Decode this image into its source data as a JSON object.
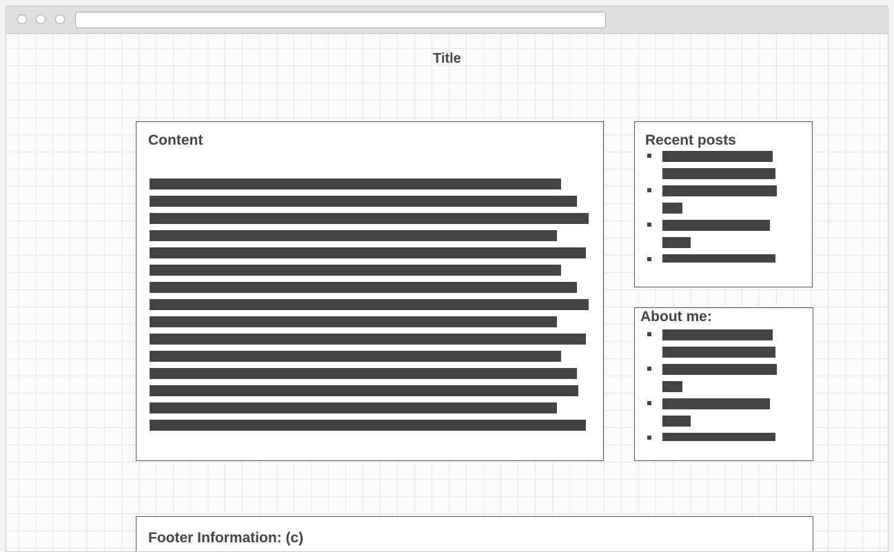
{
  "page": {
    "title": "Title"
  },
  "main": {
    "heading": "Content",
    "line_count": 15
  },
  "sidebar": {
    "recent_posts": {
      "heading": "Recent posts",
      "items_count": 4
    },
    "about": {
      "heading": "About me:",
      "items_count": 4
    }
  },
  "footer": {
    "text": "Footer Information: (c)"
  },
  "colors": {
    "placeholder_bar": "#444444",
    "grid_line": "#e6e6e6",
    "border": "#555555"
  }
}
